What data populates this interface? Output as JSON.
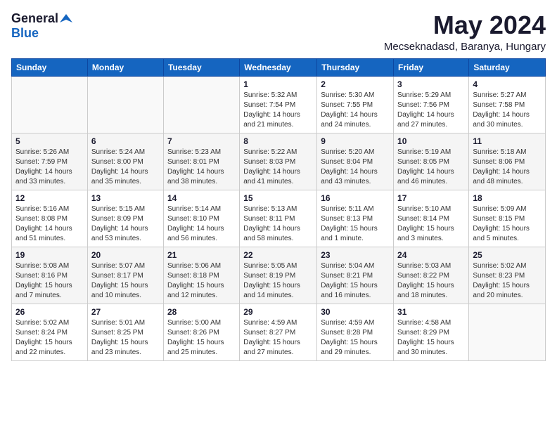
{
  "header": {
    "logo_general": "General",
    "logo_blue": "Blue",
    "month": "May 2024",
    "location": "Mecseknadasd, Baranya, Hungary"
  },
  "days_of_week": [
    "Sunday",
    "Monday",
    "Tuesday",
    "Wednesday",
    "Thursday",
    "Friday",
    "Saturday"
  ],
  "weeks": [
    [
      {
        "day": "",
        "info": ""
      },
      {
        "day": "",
        "info": ""
      },
      {
        "day": "",
        "info": ""
      },
      {
        "day": "1",
        "info": "Sunrise: 5:32 AM\nSunset: 7:54 PM\nDaylight: 14 hours\nand 21 minutes."
      },
      {
        "day": "2",
        "info": "Sunrise: 5:30 AM\nSunset: 7:55 PM\nDaylight: 14 hours\nand 24 minutes."
      },
      {
        "day": "3",
        "info": "Sunrise: 5:29 AM\nSunset: 7:56 PM\nDaylight: 14 hours\nand 27 minutes."
      },
      {
        "day": "4",
        "info": "Sunrise: 5:27 AM\nSunset: 7:58 PM\nDaylight: 14 hours\nand 30 minutes."
      }
    ],
    [
      {
        "day": "5",
        "info": "Sunrise: 5:26 AM\nSunset: 7:59 PM\nDaylight: 14 hours\nand 33 minutes."
      },
      {
        "day": "6",
        "info": "Sunrise: 5:24 AM\nSunset: 8:00 PM\nDaylight: 14 hours\nand 35 minutes."
      },
      {
        "day": "7",
        "info": "Sunrise: 5:23 AM\nSunset: 8:01 PM\nDaylight: 14 hours\nand 38 minutes."
      },
      {
        "day": "8",
        "info": "Sunrise: 5:22 AM\nSunset: 8:03 PM\nDaylight: 14 hours\nand 41 minutes."
      },
      {
        "day": "9",
        "info": "Sunrise: 5:20 AM\nSunset: 8:04 PM\nDaylight: 14 hours\nand 43 minutes."
      },
      {
        "day": "10",
        "info": "Sunrise: 5:19 AM\nSunset: 8:05 PM\nDaylight: 14 hours\nand 46 minutes."
      },
      {
        "day": "11",
        "info": "Sunrise: 5:18 AM\nSunset: 8:06 PM\nDaylight: 14 hours\nand 48 minutes."
      }
    ],
    [
      {
        "day": "12",
        "info": "Sunrise: 5:16 AM\nSunset: 8:08 PM\nDaylight: 14 hours\nand 51 minutes."
      },
      {
        "day": "13",
        "info": "Sunrise: 5:15 AM\nSunset: 8:09 PM\nDaylight: 14 hours\nand 53 minutes."
      },
      {
        "day": "14",
        "info": "Sunrise: 5:14 AM\nSunset: 8:10 PM\nDaylight: 14 hours\nand 56 minutes."
      },
      {
        "day": "15",
        "info": "Sunrise: 5:13 AM\nSunset: 8:11 PM\nDaylight: 14 hours\nand 58 minutes."
      },
      {
        "day": "16",
        "info": "Sunrise: 5:11 AM\nSunset: 8:13 PM\nDaylight: 15 hours\nand 1 minute."
      },
      {
        "day": "17",
        "info": "Sunrise: 5:10 AM\nSunset: 8:14 PM\nDaylight: 15 hours\nand 3 minutes."
      },
      {
        "day": "18",
        "info": "Sunrise: 5:09 AM\nSunset: 8:15 PM\nDaylight: 15 hours\nand 5 minutes."
      }
    ],
    [
      {
        "day": "19",
        "info": "Sunrise: 5:08 AM\nSunset: 8:16 PM\nDaylight: 15 hours\nand 7 minutes."
      },
      {
        "day": "20",
        "info": "Sunrise: 5:07 AM\nSunset: 8:17 PM\nDaylight: 15 hours\nand 10 minutes."
      },
      {
        "day": "21",
        "info": "Sunrise: 5:06 AM\nSunset: 8:18 PM\nDaylight: 15 hours\nand 12 minutes."
      },
      {
        "day": "22",
        "info": "Sunrise: 5:05 AM\nSunset: 8:19 PM\nDaylight: 15 hours\nand 14 minutes."
      },
      {
        "day": "23",
        "info": "Sunrise: 5:04 AM\nSunset: 8:21 PM\nDaylight: 15 hours\nand 16 minutes."
      },
      {
        "day": "24",
        "info": "Sunrise: 5:03 AM\nSunset: 8:22 PM\nDaylight: 15 hours\nand 18 minutes."
      },
      {
        "day": "25",
        "info": "Sunrise: 5:02 AM\nSunset: 8:23 PM\nDaylight: 15 hours\nand 20 minutes."
      }
    ],
    [
      {
        "day": "26",
        "info": "Sunrise: 5:02 AM\nSunset: 8:24 PM\nDaylight: 15 hours\nand 22 minutes."
      },
      {
        "day": "27",
        "info": "Sunrise: 5:01 AM\nSunset: 8:25 PM\nDaylight: 15 hours\nand 23 minutes."
      },
      {
        "day": "28",
        "info": "Sunrise: 5:00 AM\nSunset: 8:26 PM\nDaylight: 15 hours\nand 25 minutes."
      },
      {
        "day": "29",
        "info": "Sunrise: 4:59 AM\nSunset: 8:27 PM\nDaylight: 15 hours\nand 27 minutes."
      },
      {
        "day": "30",
        "info": "Sunrise: 4:59 AM\nSunset: 8:28 PM\nDaylight: 15 hours\nand 29 minutes."
      },
      {
        "day": "31",
        "info": "Sunrise: 4:58 AM\nSunset: 8:29 PM\nDaylight: 15 hours\nand 30 minutes."
      },
      {
        "day": "",
        "info": ""
      }
    ]
  ]
}
